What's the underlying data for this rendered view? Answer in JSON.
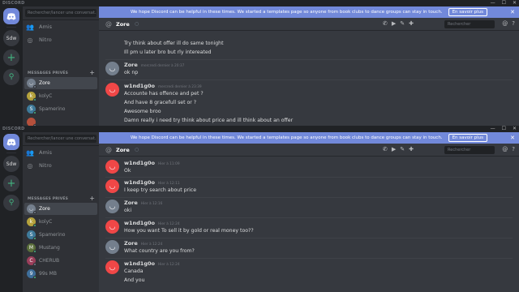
{
  "app": {
    "title": "DISCORD",
    "home_icon": "discord-logo-icon",
    "colors": {
      "brand": "#7289da",
      "online": "#43b581",
      "idle": "#faa61a",
      "dnd": "#f04747",
      "offline": "#747f8d"
    }
  },
  "window_controls": [
    "—",
    "☐",
    "✕"
  ],
  "guilds": {
    "server_abbr": "Sdw",
    "add_icon": "+",
    "search_icon": "⚲"
  },
  "search": {
    "placeholder": "Rechercher/lancer une conversat..."
  },
  "nav": {
    "friends": {
      "label": "Amis",
      "icon": "friends-icon"
    },
    "nitro": {
      "label": "Nitro",
      "icon": "nitro-icon"
    }
  },
  "dm_header": "MESSAGES PRIVÉS",
  "dm_plus": "+",
  "notice": {
    "text": "We hope Discord can be helpful in these times. We started a templates page so anyone from book clubs to dance groups can stay in touch.",
    "learn_more": "En savoir plus",
    "close": "✕"
  },
  "channel": {
    "at": "@",
    "name": "Zore",
    "status_icon": "○"
  },
  "header_search": {
    "placeholder": "Rechercher"
  },
  "window1": {
    "dms": [
      {
        "name": "Zore",
        "color": "#747f8d",
        "status": "#747f8d",
        "initial": "◡"
      },
      {
        "name": "kolyC",
        "color": "#b5a23c",
        "status": "#43b581",
        "initial": "k"
      },
      {
        "name": "Spamerino",
        "color": "#3e7a9a",
        "status": "#43b581",
        "initial": "S"
      },
      {
        "name": "",
        "color": "#b5503c",
        "status": "#747f8d",
        "initial": ""
      }
    ],
    "messages": [
      {
        "text": "Try think about offer ill do same tonight"
      },
      {
        "text": "Ill  pm  u later bro but rly intereated"
      },
      {
        "author": "Zore",
        "time": "mercredi dernier à 20:37",
        "color": "#ffffff",
        "avatar": "#747f8d",
        "lines": [
          "ok np"
        ]
      },
      {
        "author": "w1nd1g0o",
        "time": "mercredi dernier à 23:39",
        "color": "#ffffff",
        "avatar": "#f04747",
        "lines": [
          "Accounte has offence and pet ?",
          "And have 8 gracefull set or ?",
          "Awesome broo",
          "Damn really i need try think about price and ill think about an offer"
        ]
      }
    ]
  },
  "window2": {
    "dms": [
      {
        "name": "Zore",
        "color": "#747f8d",
        "status": "#747f8d",
        "initial": "◡"
      },
      {
        "name": "kolyC",
        "color": "#b5a23c",
        "status": "#43b581",
        "initial": "k"
      },
      {
        "name": "Spamerino",
        "color": "#3e7a9a",
        "status": "#43b581",
        "initial": "S"
      },
      {
        "name": "Mustang",
        "color": "#5a6e3a",
        "status": "#43b581",
        "initial": "M"
      },
      {
        "name": "CHERUB",
        "color": "#9a3e5a",
        "status": "#747f8d",
        "initial": "C"
      },
      {
        "name": "99s MB",
        "color": "#3e6e9a",
        "status": "#43b581",
        "initial": "9"
      }
    ],
    "messages": [
      {
        "author": "w1nd1g0o",
        "time": "Hier à 11:09",
        "avatar": "#f04747",
        "lines": [
          "Ok"
        ]
      },
      {
        "author": "w1nd1g0o",
        "time": "Hier à 12:11",
        "avatar": "#f04747",
        "lines": [
          "I keep try search about price"
        ]
      },
      {
        "author": "Zore",
        "time": "Hier à 12:16",
        "avatar": "#747f8d",
        "lines": [
          "oki"
        ]
      },
      {
        "author": "w1nd1g0o",
        "time": "Hier à 12:24",
        "avatar": "#f04747",
        "lines": [
          "How you want To sell it by gold or real money too??"
        ]
      },
      {
        "author": "Zore",
        "time": "Hier à 12:24",
        "avatar": "#747f8d",
        "lines": [
          "What country are you from?"
        ]
      },
      {
        "author": "w1nd1g0o",
        "time": "Hier à 12:24",
        "avatar": "#f04747",
        "lines": [
          "Canada",
          "And you"
        ]
      }
    ]
  }
}
